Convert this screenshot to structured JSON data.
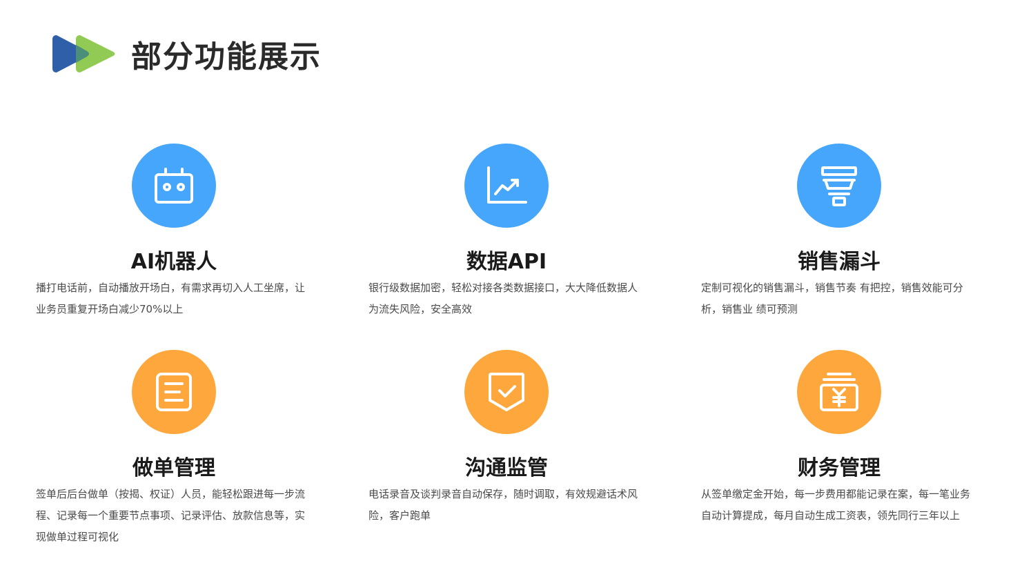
{
  "header": {
    "title": "部分功能展示",
    "logo_colors": [
      "#2f5fa8",
      "#8cc84b"
    ]
  },
  "colors": {
    "blue": "#45a6fb",
    "orange": "#fda73d"
  },
  "features": [
    {
      "icon": "robot-icon",
      "title": "AI机器人",
      "desc": "播打电话前，自动播放开场白，有需求再切入人工坐席，让业务员重复开场白减少70%以上"
    },
    {
      "icon": "chart-icon",
      "title": "数据API",
      "desc": "银行级数据加密，轻松对接各类数据接口，大大降低数据人为流失风险，安全高效"
    },
    {
      "icon": "funnel-icon",
      "title": "销售漏斗",
      "desc": "定制可视化的销售漏斗，销售节奏 有把控，销售效能可分析，销售业 绩可预测"
    },
    {
      "icon": "document-icon",
      "title": "做单管理",
      "desc": "签单后后台做单（按揭、权证）人员，能轻松跟进每一步流程、记录每一个重要节点事项、记录评估、放款信息等，实现做单过程可视化"
    },
    {
      "icon": "shield-check-icon",
      "title": "沟通监管",
      "desc": "电话录音及谈判录音自动保存，随时调取，有效规避话术风险，客户跑单"
    },
    {
      "icon": "yuan-money-icon",
      "title": "财务管理",
      "desc": "从签单缴定金开始，每一步费用都能记录在案，每一笔业务自动计算提成，每月自动生成工资表，领先同行三年以上"
    }
  ]
}
